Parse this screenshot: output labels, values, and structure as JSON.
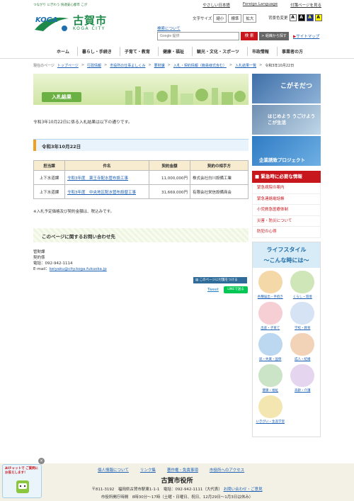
{
  "header": {
    "tagline": "つながり にぎわう 快適安心都市 こが",
    "top_links": [
      "やさしい日本語",
      "Foreign Language",
      "付箋ページを見る"
    ],
    "logo_jp": "古賀市",
    "logo_en": "KOGA CITY",
    "font_size_label": "文字サイズ",
    "font_size_options": [
      "縮小",
      "標準",
      "拡大"
    ],
    "bg_color_label": "背景色変更",
    "search_about": "検索について",
    "search_placeholder": "Google 提供",
    "search_button": "検 索",
    "org_search_button": "> 組織から探す",
    "sitemap": "サイトマップ"
  },
  "gnav": [
    "ホーム",
    "暮らし・手続き",
    "子育て・教育",
    "健康・福祉",
    "観光・文化・スポーツ",
    "市政情報",
    "事業者の方"
  ],
  "breadcrumb": {
    "label": "現在のページ",
    "items": [
      "トップページ",
      "行政情報",
      "市役所の仕事よしくみ",
      "要財課",
      "入札・契約情報（簡易様式含む）",
      "入札結果一覧"
    ],
    "current": "令和3年10月22日"
  },
  "main": {
    "page_title": "入札結果",
    "intro": "令和3年10月22日に係る入札結果は以下の通りです。",
    "section_date": "令和3年10月22日",
    "table": {
      "headers": [
        "担当課",
        "件名",
        "契約金額",
        "契約の相手方"
      ],
      "rows": [
        {
          "dept": "上下水道課",
          "title": "令和3年度　薬王寺配水管布設工事",
          "amount": "11,000,000円",
          "partner": "株式会社白川設備工業"
        },
        {
          "dept": "上下水道課",
          "title": "令和3年度　中央地区配水管布設替工事",
          "amount": "31,669,000円",
          "partner": "有限会社栄信設備商会"
        }
      ]
    },
    "note": "※入札予定価格及び契約金額は、税込みです。",
    "contact_heading": "このページに関するお問い合わせ先",
    "contact": {
      "dept": "管財課",
      "section": "契約係",
      "phone": "電話：092-942-1114",
      "email_label": "E-mail：",
      "email": "keiyaku@city.koga.fukuoka.jp"
    },
    "share_button": "このページに付箋をつける",
    "tweet": "Tweet",
    "line_button": "LINEで送る"
  },
  "sidebar": {
    "banner1": "こがそだつ",
    "banner2": "はじめよう うごけよう こが生活",
    "banner3": "企業誘致プロジェクト",
    "emergency_heading": "緊急時に必要な情報",
    "emergency_items": [
      "緊急病院の案内",
      "緊急連絡電話帳",
      "小児救急医療体制",
      "災害・防災について",
      "防犯の心得"
    ],
    "life_heading_1": "ライフスタイル",
    "life_heading_2": "〜こんな時には〜",
    "life_items": [
      "各種届出・手続き",
      "くらし・環境",
      "出産・子育て",
      "学校・教育",
      "就・失業・国保",
      "成人・結婚",
      "健康・福祉",
      "高齢・介護",
      "いきがい・生涯学習"
    ]
  },
  "footer": {
    "links": [
      "個人情報について",
      "リンク集",
      "著作権・免責事項",
      "市役所へのアクセス"
    ],
    "title": "古賀市役所",
    "address": "〒811-3192　福岡県古賀市駅東1-1-1　電話：092-942-1111（大代表）",
    "inquiry": "お問い合わせ・ご意見",
    "hours": "市役所開庁時間　8時30分〜17時（土曜・日曜日、祝日、12月29日〜1月3日は休み）"
  },
  "chat": {
    "text": "AIチャットで ご質問にお答えします！",
    "close": "×"
  },
  "colors": {
    "brand_green": "#1e8a4a",
    "accent_red": "#c8161d",
    "link_blue": "#1a5fb4"
  }
}
